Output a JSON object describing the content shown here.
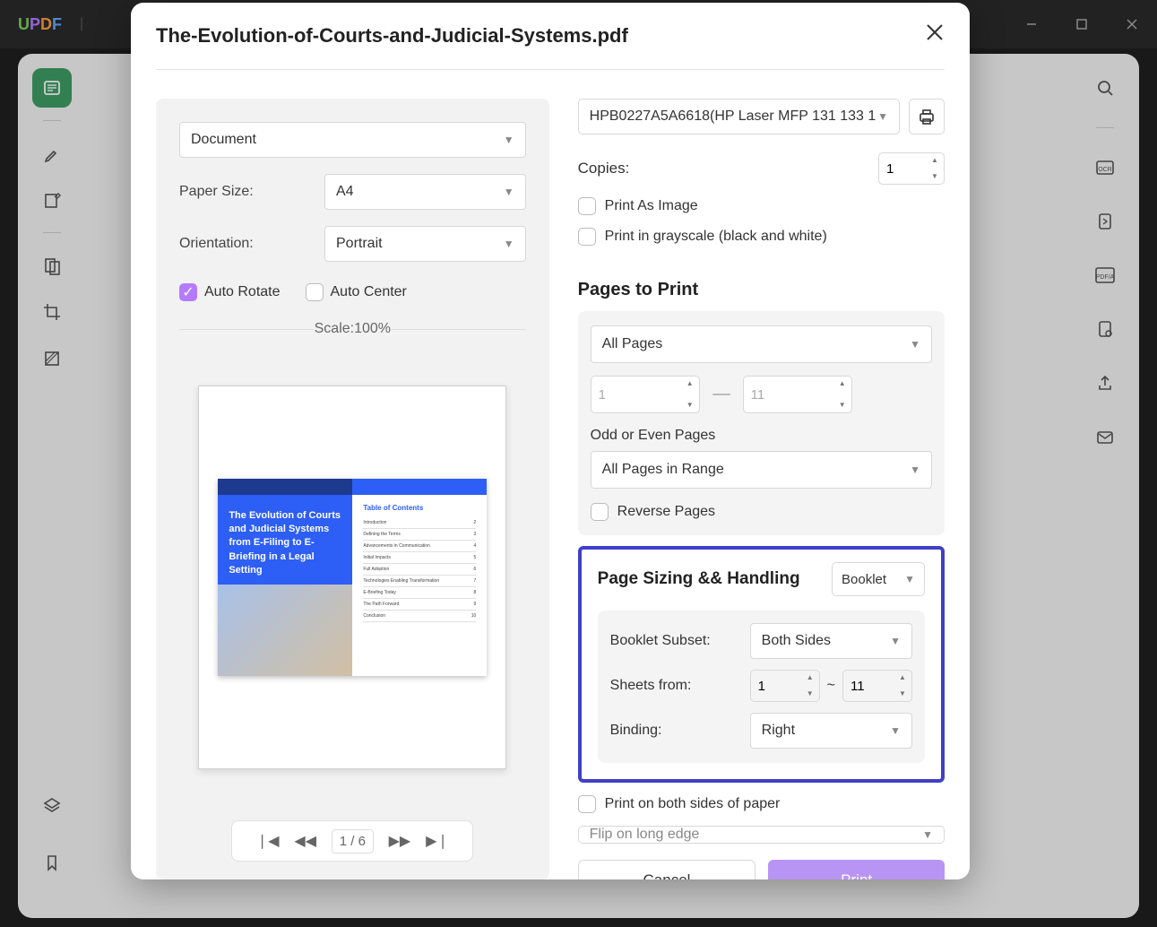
{
  "app": {
    "logo": "UPDF"
  },
  "dialog": {
    "title": "The-Evolution-of-Courts-and-Judicial-Systems.pdf",
    "left": {
      "mode": "Document",
      "paperSizeLabel": "Paper Size:",
      "paperSize": "A4",
      "orientationLabel": "Orientation:",
      "orientation": "Portrait",
      "autoRotate": "Auto Rotate",
      "autoCenter": "Auto Center",
      "scale": "Scale:100%",
      "previewTitle": "The Evolution of Courts and Judicial Systems from E-Filing to E-Briefing in a Legal Setting",
      "tocTitle": "Table of Contents",
      "pager": {
        "current": "1",
        "sep": "/",
        "total": "6"
      }
    },
    "right": {
      "printer": "HPB0227A5A6618(HP Laser MFP 131 133 1",
      "copiesLabel": "Copies:",
      "copies": "1",
      "printAsImage": "Print As Image",
      "grayscale": "Print in grayscale (black and white)",
      "pagesToPrint": "Pages to Print",
      "allPages": "All Pages",
      "rangeFrom": "1",
      "rangeTo": "11",
      "oddEvenLabel": "Odd or Even Pages",
      "oddEven": "All Pages in Range",
      "reversePages": "Reverse Pages",
      "sizingTitle": "Page Sizing && Handling",
      "sizingMode": "Booklet",
      "subsetLabel": "Booklet Subset:",
      "subset": "Both Sides",
      "sheetsLabel": "Sheets from:",
      "sheetsFrom": "1",
      "sheetsTo": "11",
      "bindingLabel": "Binding:",
      "binding": "Right",
      "bothSides": "Print on both sides of paper",
      "flip": "Flip on long edge",
      "cancel": "Cancel",
      "print": "Print"
    }
  }
}
